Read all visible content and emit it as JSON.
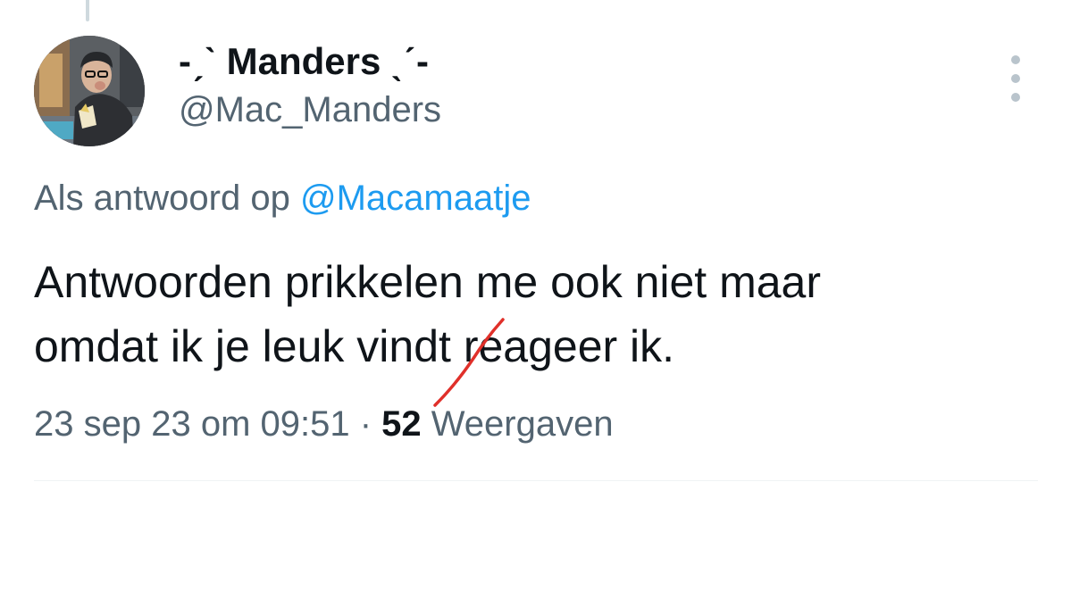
{
  "author": {
    "display_name": "-ˏˋ Manders ˎˊ-",
    "handle": "@Mac_Manders"
  },
  "reply": {
    "prefix": "Als antwoord op",
    "mention": "@Macamaatje"
  },
  "tweet": {
    "line1": "Antwoorden prikkelen me ook niet maar",
    "line2_before": "omdat ik je leuk vind",
    "line2_struck": "t",
    "line2_after": " reageer ik."
  },
  "meta": {
    "timestamp": "23 sep 23 om 09:51",
    "separator": " · ",
    "views_count": "52",
    "views_label": " Weergaven"
  },
  "icons": {
    "more": "more-vertical-icon"
  },
  "colors": {
    "text_primary": "#0f1419",
    "text_secondary": "#536471",
    "link": "#1d9bf0",
    "strike_annotation": "#e0302a"
  }
}
